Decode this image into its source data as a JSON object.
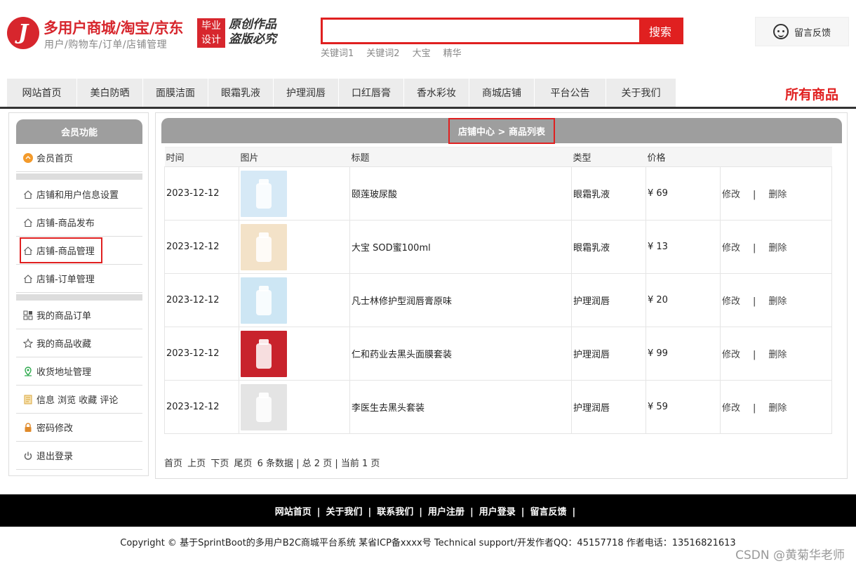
{
  "header": {
    "logo_letter": "J",
    "site_title": "多用户商城/淘宝/京东",
    "site_subtitle": "用户/购物车/订单/店铺管理",
    "badge_line1": "毕业",
    "badge_line2": "设计",
    "slogan_line1": "原创作品",
    "slogan_line2": "盗版必究",
    "search_placeholder": "",
    "search_button": "搜索",
    "keywords": [
      "关键词1",
      "关键词2",
      "大宝",
      "精华"
    ],
    "feedback_label": "留言反馈"
  },
  "nav": {
    "items": [
      "网站首页",
      "美白防晒",
      "面膜洁面",
      "眼霜乳液",
      "护理润唇",
      "口红唇膏",
      "香水彩妆",
      "商城店铺",
      "平台公告",
      "关于我们"
    ],
    "all_goods": "所有商品"
  },
  "sidebar": {
    "title": "会员功能",
    "items": [
      {
        "label": "会员首页",
        "icon": "member-home-icon"
      },
      {
        "label": "店铺和用户信息设置",
        "icon": "home-icon"
      },
      {
        "label": "店铺-商品发布",
        "icon": "home-icon"
      },
      {
        "label": "店铺-商品管理",
        "icon": "home-icon"
      },
      {
        "label": "店铺-订单管理",
        "icon": "home-icon"
      },
      {
        "label": "我的商品订单",
        "icon": "grid-icon"
      },
      {
        "label": "我的商品收藏",
        "icon": "star-icon"
      },
      {
        "label": "收货地址管理",
        "icon": "location-icon"
      },
      {
        "label": "信息 浏览 收藏 评论",
        "icon": "document-icon"
      },
      {
        "label": "密码修改",
        "icon": "lock-icon"
      },
      {
        "label": "退出登录",
        "icon": "power-icon"
      }
    ]
  },
  "main": {
    "breadcrumb": "店铺中心 > 商品列表",
    "columns": [
      "时间",
      "图片",
      "标题",
      "类型",
      "价格",
      ""
    ],
    "rows": [
      {
        "time": "2023-12-12",
        "title": "颐莲玻尿酸",
        "type": "眼霜乳液",
        "price": "¥ 69",
        "edit": "修改",
        "sep": "|",
        "delete": "删除",
        "img_color": "#d6e9f6"
      },
      {
        "time": "2023-12-12",
        "title": "大宝 SOD蜜100ml",
        "type": "眼霜乳液",
        "price": "¥ 13",
        "edit": "修改",
        "sep": "|",
        "delete": "删除",
        "img_color": "#f3e2c8"
      },
      {
        "time": "2023-12-12",
        "title": "凡士林修护型润唇膏原味",
        "type": "护理润唇",
        "price": "¥ 20",
        "edit": "修改",
        "sep": "|",
        "delete": "删除",
        "img_color": "#cde6f4"
      },
      {
        "time": "2023-12-12",
        "title": "仁和药业去黑头面膜套装",
        "type": "护理润唇",
        "price": "¥ 99",
        "edit": "修改",
        "sep": "|",
        "delete": "删除",
        "img_color": "#c8232c"
      },
      {
        "time": "2023-12-12",
        "title": "李医生去黑头套装",
        "type": "护理润唇",
        "price": "¥ 59",
        "edit": "修改",
        "sep": "|",
        "delete": "删除",
        "img_color": "#e4e4e4"
      }
    ],
    "pager": {
      "first": "首页",
      "prev": "上页",
      "next": "下页",
      "last": "尾页",
      "summary": "6 条数据 | 总 2 页 | 当前 1 页"
    }
  },
  "footer": {
    "links": [
      "网站首页",
      "关于我们",
      "联系我们",
      "用户注册",
      "用户登录",
      "留言反馈"
    ],
    "separator": "|",
    "copyright": "Copyright © 基于SprintBoot的多用户B2C商城平台系统    某省ICP备xxxx号    Technical support/开发作者QQ：45157718     作者电话：13516821613",
    "watermark": "CSDN @黄菊华老师"
  },
  "colors": {
    "accent": "#e02020",
    "brand": "#d7262d",
    "panel_header": "#9e9e9e"
  }
}
